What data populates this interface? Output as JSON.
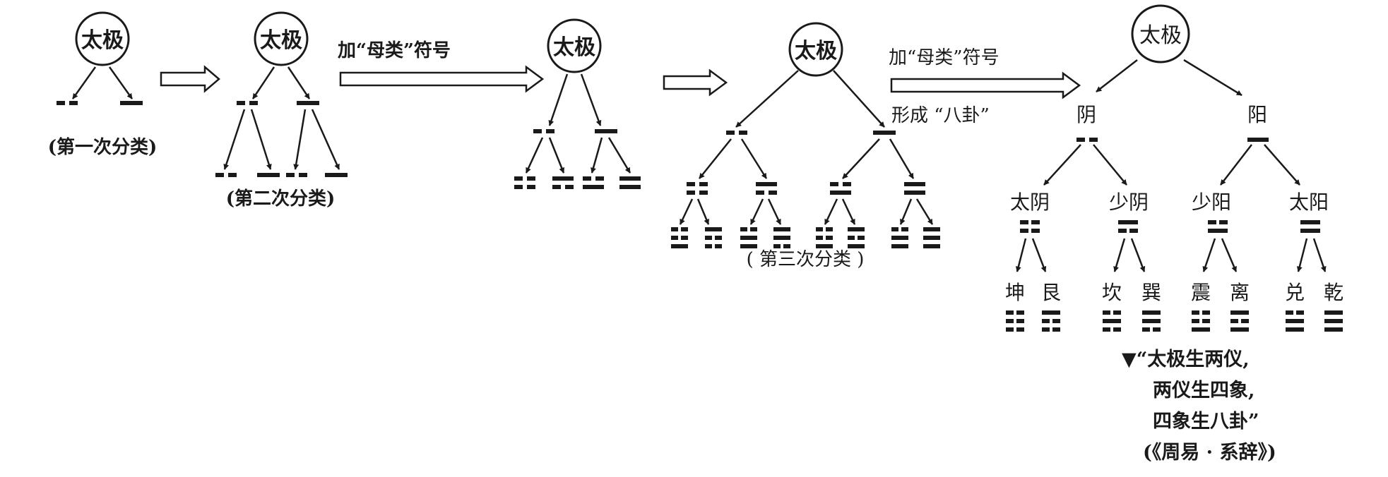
{
  "taiji": "太极",
  "arrow_text": {
    "add_mother_class": "加“母类”符号",
    "form_bagua": "形成 “八卦”"
  },
  "captions": {
    "first": "(第一次分类)",
    "second": "(第二次分类)",
    "third": "( 第三次分类 )"
  },
  "liangyi": {
    "yin": "阴",
    "yang": "阳"
  },
  "sixiang": [
    "太阴",
    "少阴",
    "少阳",
    "太阳"
  ],
  "bagua": [
    "坤",
    "艮",
    "坎",
    "巽",
    "震",
    "离",
    "兑",
    "乾"
  ],
  "quote": {
    "line1": "▼“太极生两仪,",
    "line2": "两仪生四象,",
    "line3": "四象生八卦”",
    "source": "(《周易 · 系辞》)"
  }
}
